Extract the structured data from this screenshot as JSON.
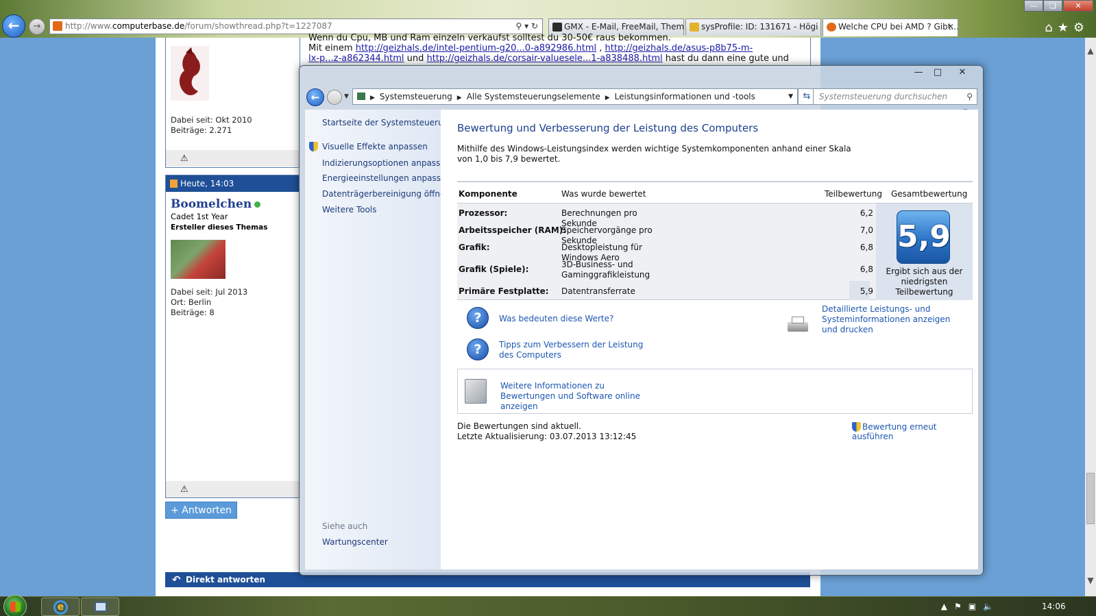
{
  "browser": {
    "address_prefix": "http://www.",
    "address_domain": "computerbase.de",
    "address_path": "/forum/showthread.php?t=1227087",
    "tabs": [
      {
        "label": "GMX - E-Mail, FreeMail, Them..."
      },
      {
        "label": "sysProfile: ID: 131671 - Högi"
      },
      {
        "label": "Welche CPU bei AMD ? Gibt..."
      }
    ]
  },
  "forum": {
    "post1": {
      "joined": "Dabei seit: Okt 2010",
      "posts": "Beiträge: 2.271"
    },
    "post2": {
      "timestamp": "Heute, 14:03",
      "username": "Boomelchen",
      "rank": "Cadet 1st Year",
      "starter": "Ersteller dieses Themas",
      "joined": "Dabei seit: Jul 2013",
      "location": "Ort: Berlin",
      "posts": "Beiträge: 8"
    },
    "text": {
      "line1": "Wenn du Cpu, MB und Ram einzeln verkaufst solltest du 30-50€ raus bekommen.",
      "line2_prefix": "Mit einem ",
      "link1": "http://geizhals.de/intel-pentium-g20...0-a892986.html",
      "line2_sep": " , ",
      "link2": "http://geizhals.de/asus-p8b75-m-",
      "link2b": "lx-p...z-a862344.html",
      "line3_und": " und ",
      "link3": "http://geizhals.de/corsair-valuesele...1-a838488.html",
      "line3_suffix": " hast du dann eine gute und"
    },
    "reply_button": "+ Antworten",
    "direct_reply": "Direkt antworten"
  },
  "control_panel": {
    "breadcrumb": [
      "Systemsteuerung",
      "Alle Systemsteuerungselemente",
      "Leistungsinformationen und -tools"
    ],
    "search_placeholder": "Systemsteuerung durchsuchen",
    "sidebar": {
      "home": "Startseite der Systemsteuerung",
      "items": [
        "Visuelle Effekte anpassen",
        "Indizierungsoptionen anpassen",
        "Energieeinstellungen anpassen",
        "Datenträgerbereinigung öffnen",
        "Weitere Tools"
      ],
      "see_also": "Siehe auch",
      "maintenance": "Wartungscenter"
    },
    "title": "Bewertung und Verbesserung der Leistung des Computers",
    "description": "Mithilfe des Windows-Leistungsindex werden wichtige Systemkomponenten anhand einer Skala von 1,0 bis 7,9 bewertet.",
    "table": {
      "headers": [
        "Komponente",
        "Was wurde bewertet",
        "Teilbewertung",
        "Gesamtbewertung"
      ],
      "rows": [
        {
          "component": "Prozessor:",
          "rated": "Berechnungen pro Sekunde",
          "score": "6,2"
        },
        {
          "component": "Arbeitsspeicher (RAM):",
          "rated": "Speichervorgänge pro Sekunde",
          "score": "7,0"
        },
        {
          "component": "Grafik:",
          "rated": "Desktopleistung für Windows Aero",
          "score": "6,8"
        },
        {
          "component": "Grafik (Spiele):",
          "rated": "3D-Business- und Gaminggrafikleistung",
          "score": "6,8"
        },
        {
          "component": "Primäre Festplatte:",
          "rated": "Datentransferrate",
          "score": "5,9"
        }
      ],
      "overall_score": "5,9",
      "overall_caption": "Ergibt sich aus der niedrigsten Teilbewertung"
    },
    "links": {
      "what_mean": "Was bedeuten diese Werte?",
      "tips": "Tipps zum Verbessern der Leistung des Computers",
      "detailed": "Detaillierte Leistungs- und Systeminformationen anzeigen und drucken",
      "more_info": "Weitere Informationen zu Bewertungen und Software online anzeigen"
    },
    "status": "Die Bewertungen sind aktuell.",
    "last_update": "Letzte Aktualisierung: 03.07.2013 13:12:45",
    "rerun": "Bewertung erneut ausführen"
  },
  "taskbar": {
    "clock": "14:06"
  }
}
